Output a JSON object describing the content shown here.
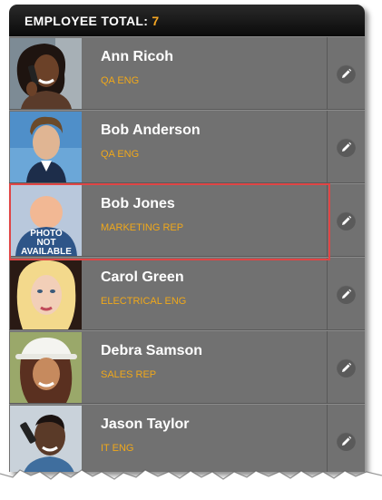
{
  "header": {
    "label": "EMPLOYEE TOTAL:",
    "count": "7"
  },
  "employees": [
    {
      "name": "Ann Ricoh",
      "title": "QA ENG",
      "photo": "woman-on-phone"
    },
    {
      "name": "Bob Anderson",
      "title": "QA ENG",
      "photo": "man-portrait"
    },
    {
      "name": "Bob Jones",
      "title": "MARKETING REP",
      "photo": "photo-not-available",
      "placeholder_text": [
        "PHOTO",
        "NOT",
        "AVAILABLE"
      ],
      "selected": true
    },
    {
      "name": "Carol Green",
      "title": "ELECTRICAL ENG",
      "photo": "blonde-woman"
    },
    {
      "name": "Debra Samson",
      "title": "SALES REP",
      "photo": "woman-white-hat"
    },
    {
      "name": "Jason Taylor",
      "title": "IT ENG",
      "photo": "man-on-phone"
    }
  ],
  "colors": {
    "accent": "#f0a81a",
    "selection": "#e04545",
    "panel": "#717171",
    "header": "#111111"
  },
  "icons": {
    "edit": "pencil-icon"
  }
}
